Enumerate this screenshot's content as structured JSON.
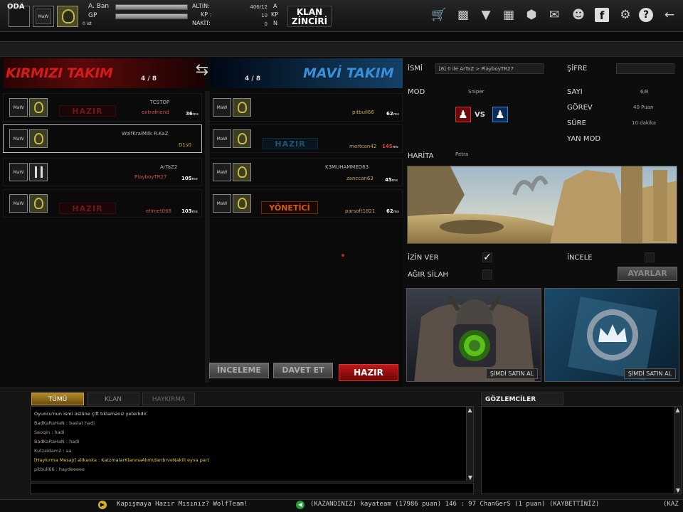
{
  "topbar": {
    "slot_label": "MaW",
    "stats": {
      "name_label": "A. Ban",
      "gp_label": "GP",
      "gp_value": "0 ist",
      "gold_label": "ALTIN:",
      "gold_value": "406/12",
      "gold_sym": "A",
      "kp_label": "KP :",
      "kp_value": "10",
      "kp_sym": "KP",
      "cash_label": "NAKİT:",
      "cash_value": "0",
      "cash_sym": "N"
    },
    "klan_line1": "KLAN",
    "klan_line2": "ZİNCİRİ",
    "icons": [
      "cart-icon",
      "briefcase-icon",
      "wolf-icon",
      "book-icon",
      "box-icon",
      "mail-icon",
      "friends-icon",
      "facebook-icon",
      "gear-icon",
      "help-icon",
      "back-arrow-icon"
    ]
  },
  "room": {
    "label": "ODA",
    "swap_glyph": "⇆"
  },
  "red_team": {
    "title": "KIRMIZI TAKIM",
    "count": "4 / 8",
    "players": [
      {
        "name": "TCSTOP",
        "sub": "extrafriend",
        "ping": "36",
        "unit": "ms",
        "status": "HAZIR"
      },
      {
        "name": "WolfKralMilk R.KaZ",
        "sub": "D1s0",
        "ping": "",
        "unit": "",
        "status": ""
      },
      {
        "name": "ArTaZ2",
        "sub": "PlayboyTR27",
        "ping": "105",
        "unit": "ms",
        "status": ""
      },
      {
        "name": "",
        "sub": "ehmet068",
        "ping": "103",
        "unit": "ms",
        "status": "HAZIR"
      }
    ]
  },
  "blue_team": {
    "title": "MAVİ TAKIM",
    "count": "4 / 8",
    "players": [
      {
        "name": "",
        "sub": "pitbull66",
        "ping": "62",
        "unit": "ms",
        "status": ""
      },
      {
        "name": "",
        "sub": "mertcan42",
        "ping": "145",
        "unit": "ms",
        "status": "HAZIR"
      },
      {
        "name": "K3MUHAMMED63",
        "sub": "zanccan63",
        "ping": "45",
        "unit": "ms",
        "status": ""
      },
      {
        "name": "",
        "sub": "parsoft1821",
        "ping": "62",
        "unit": "ms",
        "status": "YÖNETİCİ"
      }
    ]
  },
  "bottom_buttons": {
    "inceleme": "İNCELEME",
    "davet": "DAVET ET",
    "hazir": "HAZIR"
  },
  "settings": {
    "name_label": "İSMİ",
    "name_value": "[6] 0 ile ArTaZ > PlayboyTR27",
    "password_label": "ŞİFRE",
    "mode_label": "MOD",
    "mode_value": "Sniper",
    "vs": "VS",
    "count_label": "SAYI",
    "count_value": "6/8",
    "mission_label": "GÖREV",
    "mission_value": "40 Puan",
    "time_label": "SÜRE",
    "time_value": "10 dakika",
    "side_mode_label": "YAN MOD",
    "map_label": "HARİTA",
    "map_value": "Petra",
    "allow_label": "İZİN VER",
    "allow_checked": true,
    "heavy_label": "AĞIR SİLAH",
    "heavy_checked": false,
    "inspect_label": "İNCELE",
    "inspect_checked": false,
    "settings_button": "AYARLAR"
  },
  "ads": [
    {
      "buy": "ŞİMDİ SATIN AL"
    },
    {
      "buy": "ŞİMDİ SATIN AL"
    }
  ],
  "chat": {
    "tabs": [
      "TÜMÜ",
      "KLAN",
      "HAYKIRMA"
    ],
    "lines": [
      {
        "text": "Oyuncu'nun ismi üstüne çift tıklamanız yeterlidir.",
        "color": "#d8d8d8"
      },
      {
        "text": "BadKaRaHaN : baslat hadi",
        "color": "#b0a090"
      },
      {
        "text": "Seoqin : hadi",
        "color": "#b0a090"
      },
      {
        "text": "BadKaRaHaN : hadi",
        "color": "#b0a090"
      },
      {
        "text": "Kutzaldam2 : aa",
        "color": "#b0a090"
      },
      {
        "text": "[Haykırma Mesajı] alikanka : KatzmalarKlanınaAlım\\dardırveNakili eyva part",
        "color": "#e0d020"
      },
      {
        "text": "pitbull66 : haydeeeee",
        "color": "#b0a090"
      }
    ],
    "observers_title": "GÖZLEMCİLER"
  },
  "ticker": {
    "msg1": "Kapışmaya Hazır Mısınız? WolfTeam!",
    "msg2": "(KAZANDINIZ) kayateam (17986 puan) 146 : 97 ChanGerS (1 puan) (KAYBETTİNİZ)",
    "msg3": "(KAZ"
  }
}
